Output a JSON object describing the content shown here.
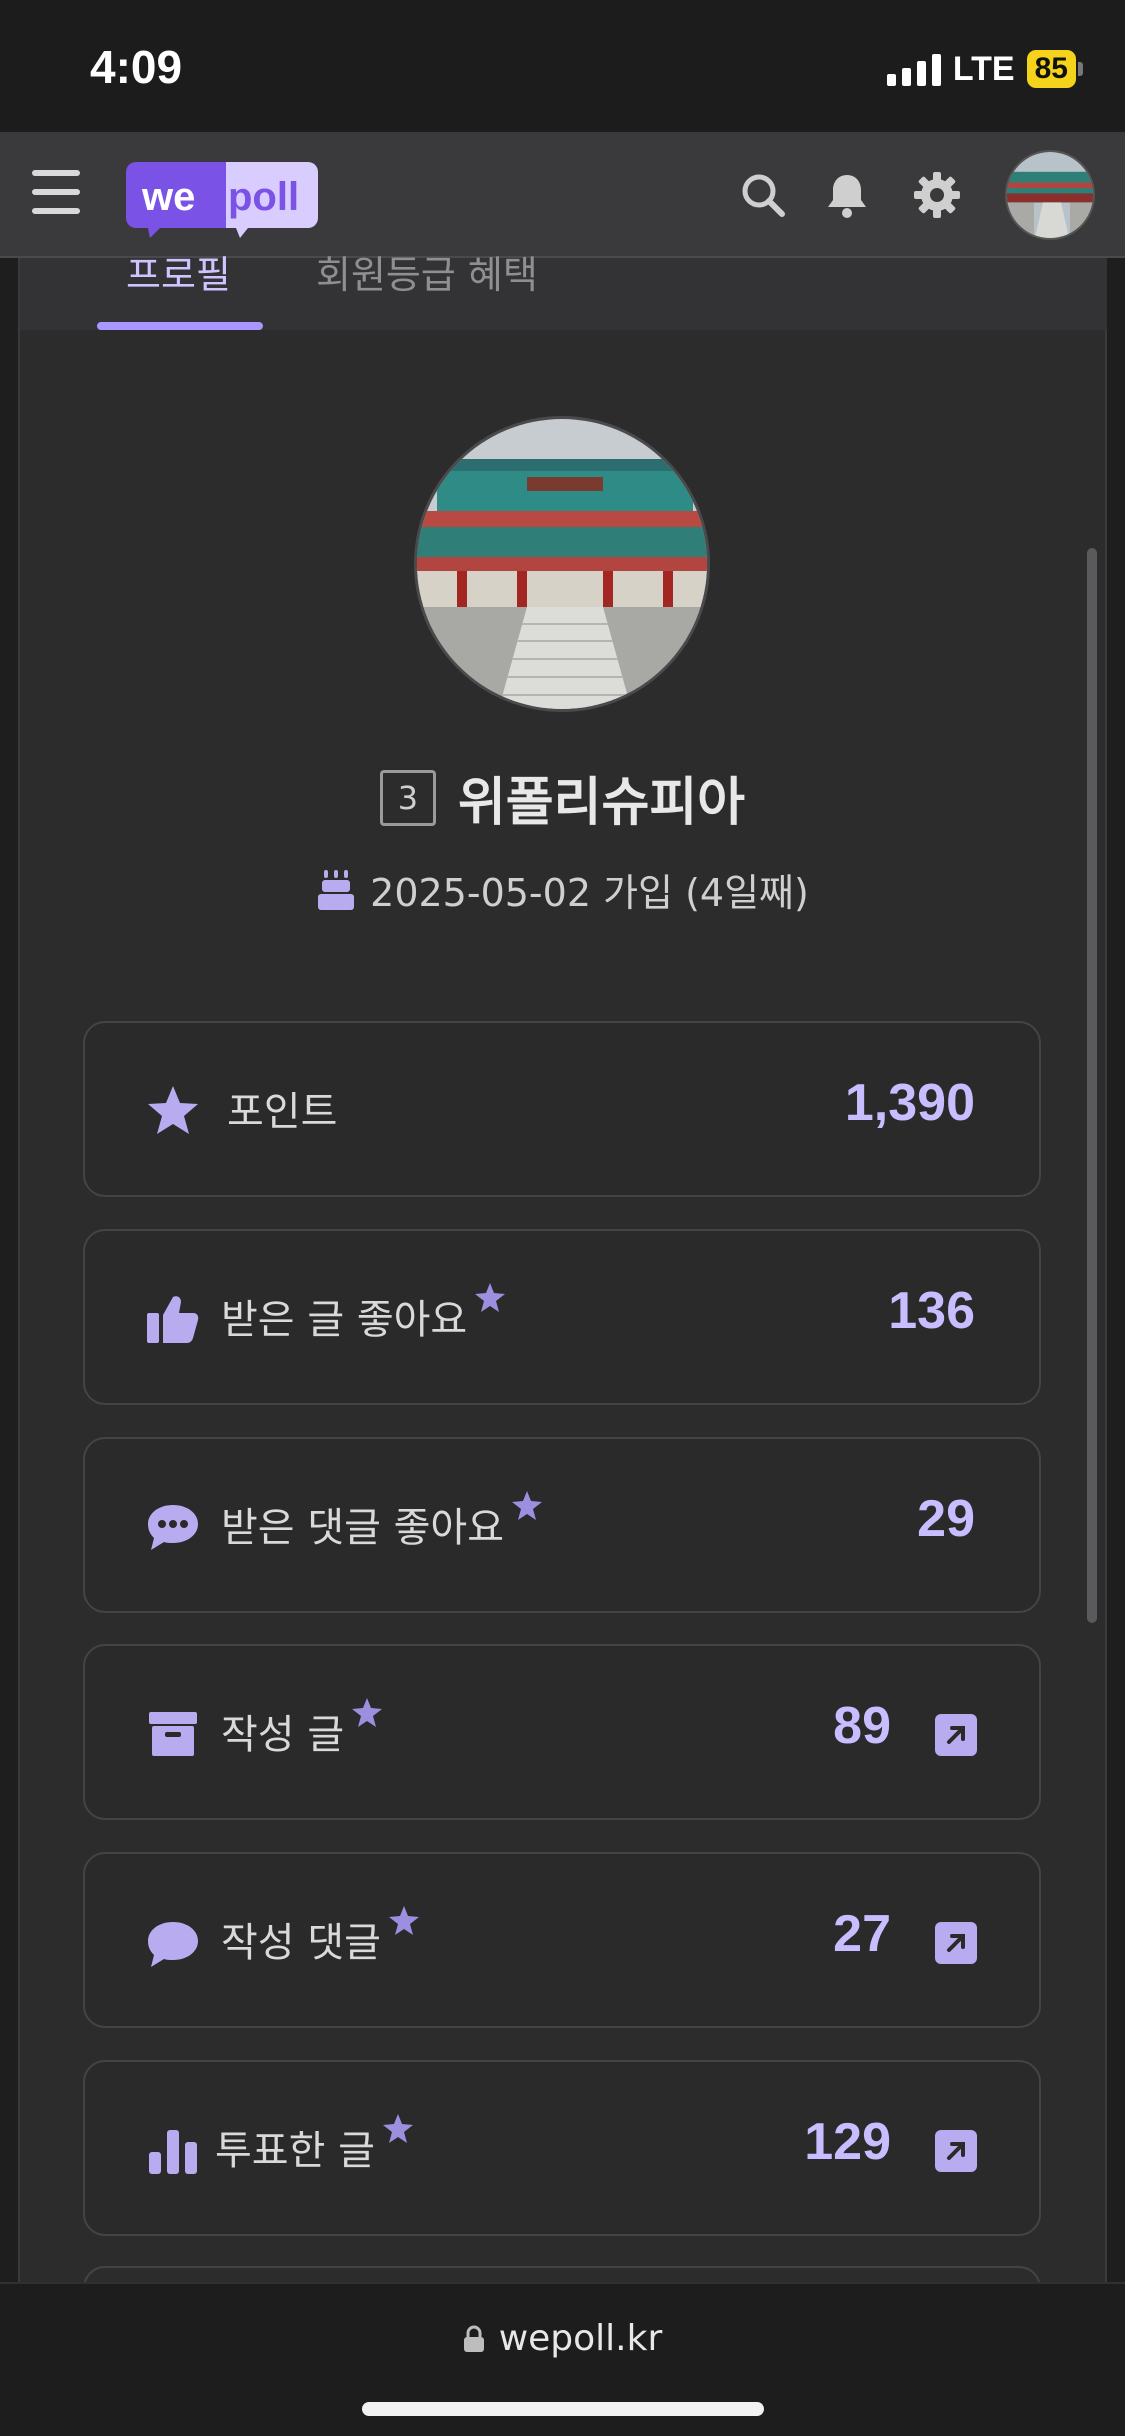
{
  "status_bar": {
    "time": "4:09",
    "network": "LTE",
    "battery": "85"
  },
  "header": {
    "logo_left": "we",
    "logo_right": "poll"
  },
  "tabs": [
    {
      "label": "프로필",
      "active": true
    },
    {
      "label": "회원등급 혜택",
      "active": false
    }
  ],
  "profile": {
    "level": "3",
    "username": "위폴리슈피아",
    "joined": "2025-05-02 가입 (4일째)"
  },
  "stats": [
    {
      "icon": "star-icon",
      "label": "포인트",
      "value": "1,390",
      "starred": false,
      "link": false
    },
    {
      "icon": "thumbs-up-icon",
      "label": "받은 글 좋아요",
      "value": "136",
      "starred": true,
      "link": false
    },
    {
      "icon": "comment-dots-icon",
      "label": "받은 댓글 좋아요",
      "value": "29",
      "starred": true,
      "link": false
    },
    {
      "icon": "archive-box-icon",
      "label": "작성 글",
      "value": "89",
      "starred": true,
      "link": true
    },
    {
      "icon": "speech-bubble-icon",
      "label": "작성 댓글",
      "value": "27",
      "starred": true,
      "link": true
    },
    {
      "icon": "bar-chart-icon",
      "label": "투표한 글",
      "value": "129",
      "starred": true,
      "link": true
    }
  ],
  "url_bar": {
    "domain": "wepoll.kr"
  },
  "colors": {
    "accent": "#a996ff",
    "stat_value": "#c8bdff",
    "icon": "#b8abf0",
    "logo_purple": "#7b52e6",
    "logo_light": "#d9ccff"
  }
}
